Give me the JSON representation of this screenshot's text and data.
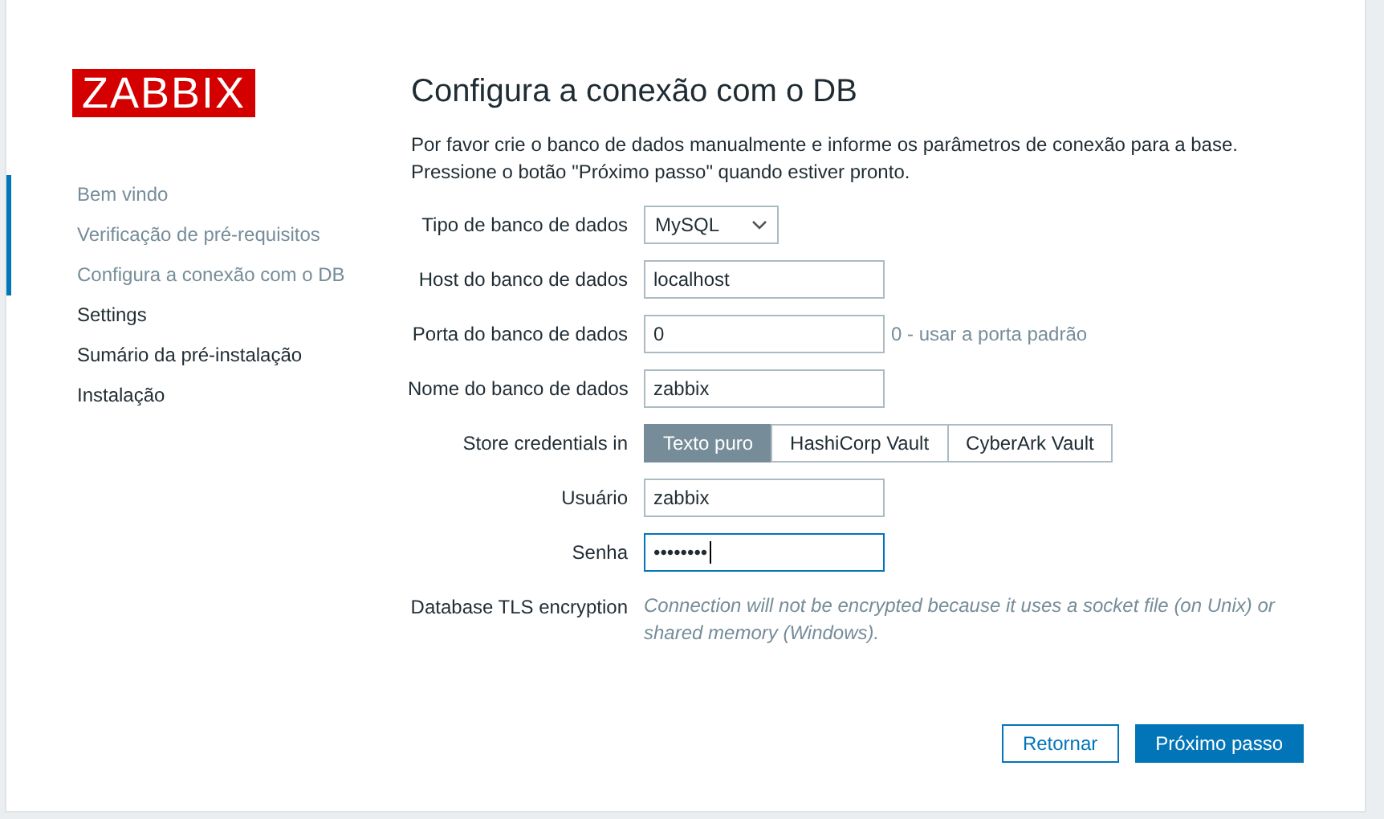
{
  "logo": "ZABBIX",
  "steps": [
    {
      "label": "Bem vindo",
      "completed": true
    },
    {
      "label": "Verificação de pré-requisitos",
      "completed": true
    },
    {
      "label": "Configura a conexão com o DB",
      "completed": true
    },
    {
      "label": "Settings",
      "completed": false
    },
    {
      "label": "Sumário da pré-instalação",
      "completed": false
    },
    {
      "label": "Instalação",
      "completed": false
    }
  ],
  "title": "Configura a conexão com o DB",
  "intro": [
    "Por favor crie o banco de dados manualmente e informe os parâmetros de conexão para a base.",
    "Pressione o botão \"Próximo passo\" quando estiver pronto."
  ],
  "fields": [
    {
      "kind": "select",
      "label": "Tipo de banco de dados",
      "value": "MySQL"
    },
    {
      "kind": "input",
      "label": "Host do banco de dados",
      "value": "localhost"
    },
    {
      "kind": "input",
      "label": "Porta do banco de dados",
      "value": "0",
      "hint": "0 - usar a porta padrão"
    },
    {
      "kind": "input",
      "label": "Nome do banco de dados",
      "value": "zabbix"
    },
    {
      "kind": "segmented",
      "label": "Store credentials in",
      "options": [
        {
          "label": "Texto puro",
          "selected": true
        },
        {
          "label": "HashiCorp Vault",
          "selected": false
        },
        {
          "label": "CyberArk Vault",
          "selected": false
        }
      ]
    },
    {
      "kind": "input",
      "label": "Usuário",
      "value": "zabbix"
    },
    {
      "kind": "password",
      "label": "Senha",
      "value": "••••••••",
      "focused": true
    },
    {
      "kind": "note",
      "label": "Database TLS encryption",
      "value": "Connection will not be encrypted because it uses a socket file (on Unix) or shared memory (Windows)."
    }
  ],
  "buttons": {
    "back": "Retornar",
    "next": "Próximo passo"
  }
}
